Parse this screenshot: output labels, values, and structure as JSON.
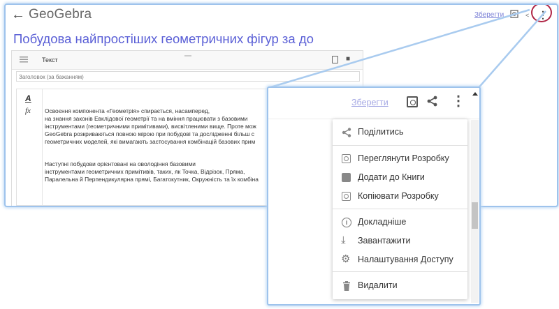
{
  "app": {
    "logo": "GeoGebra",
    "save_label": "Зберегти",
    "page_title": "Побудова найпростіших геометричних фігур за до"
  },
  "editor": {
    "type_label": "Текст",
    "heading_placeholder": "Заголовок (за бажанням)",
    "paragraphs": [
      "Освоєння компонента «Геометрія» спирається, насамперед,\nна знання законів Евклідової геометрії та на вміння працювати з базовими\nінструментами (геометричними примітивами), висвітленими вище. Проте мож\nGeoGebra розкриваються повною мірою при побудові та дослідженні більш с\nгеометричних моделей, які вимагають застосування комбінацій базових прим",
      "Наступні побудови орієнтовані на оволодіння базовими\nінструментами геометричних примітивів, таких, як Точка, Відрізок, Пряма,\nПаралельна й Перпендикулярна прямі, Багатокутник, Окружність та їх комбіна"
    ]
  },
  "zoom": {
    "save_label": "Зберегти",
    "menu": [
      {
        "label": "Поділитись",
        "icon": "share-icon"
      },
      {
        "label": "Переглянути Розробку",
        "icon": "view-activity-icon"
      },
      {
        "label": "Додати до Книги",
        "icon": "add-to-book-icon"
      },
      {
        "label": "Копіювати Розробку",
        "icon": "copy-activity-icon"
      },
      {
        "label": "Докладніше",
        "icon": "info-icon"
      },
      {
        "label": "Завантажити",
        "icon": "download-icon"
      },
      {
        "label": "Налаштування Доступу",
        "icon": "gear-icon"
      },
      {
        "label": "Видалити",
        "icon": "trash-icon"
      }
    ]
  },
  "colors": {
    "accent": "#5a5fd6",
    "highlight_circle": "#b02646",
    "frame": "#9ec3ec"
  }
}
